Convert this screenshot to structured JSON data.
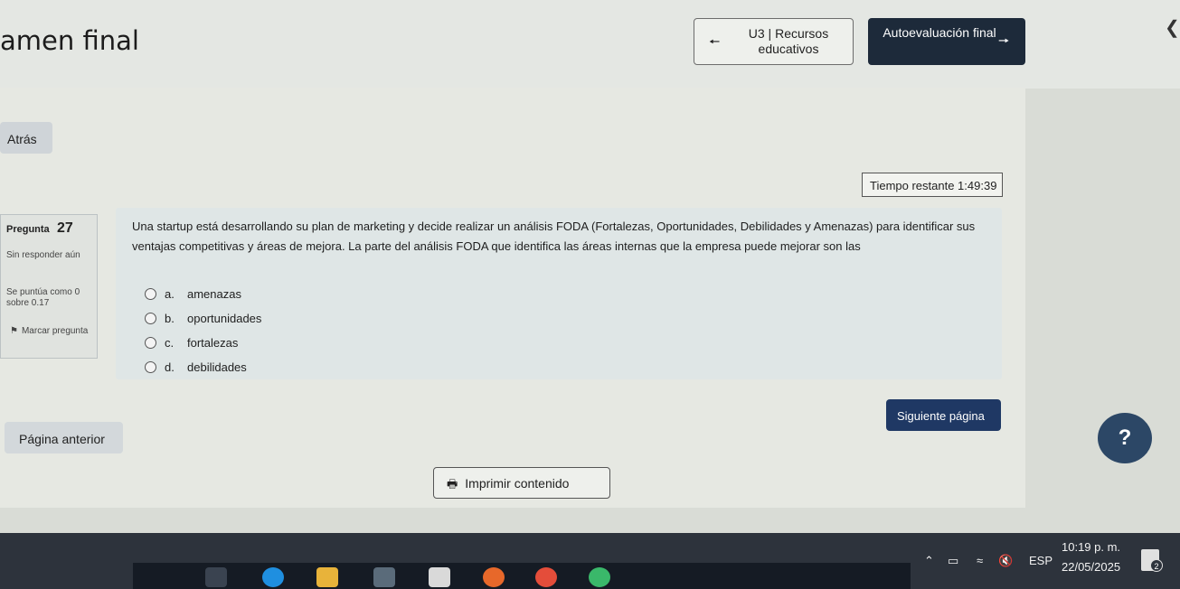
{
  "header": {
    "title": "amen final",
    "prev_nav_label": "U3 | Recursos educativos",
    "next_nav_label": "Autoevaluación final"
  },
  "nav": {
    "back_label": "Atrás",
    "timer_label": "Tiempo restante 1:49:39"
  },
  "question": {
    "label": "Pregunta",
    "number": "27",
    "state": "Sin responder aún",
    "score": "Se puntúa como 0 sobre 0.17",
    "flag_label": "Marcar pregunta",
    "text": "Una startup está desarrollando su plan de marketing y decide realizar un análisis FODA (Fortalezas, Oportunidades, Debilidades y Amenazas) para identificar sus ventajas competitivas y áreas de mejora. La parte del análisis FODA que identifica las áreas internas que la empresa puede mejorar son las",
    "answers": [
      {
        "letter": "a.",
        "text": "amenazas"
      },
      {
        "letter": "b.",
        "text": "oportunidades"
      },
      {
        "letter": "c.",
        "text": "fortalezas"
      },
      {
        "letter": "d.",
        "text": "debilidades"
      }
    ]
  },
  "footer": {
    "prev_page_label": "Página anterior",
    "next_page_label": "Siguiente página",
    "print_label": "Imprimir contenido",
    "help_label": "?"
  },
  "taskbar": {
    "language": "ESP",
    "time": "10:19 p. m.",
    "date": "22/05/2025",
    "notifications": "2"
  },
  "icons": {
    "prev_arrow": "arrow-left-icon",
    "next_arrow": "arrow-right-icon",
    "print": "printer-icon",
    "flag": "flag-icon"
  },
  "colors": {
    "primary_dark": "#1d2a3a",
    "next_page_button": "#1f3864",
    "question_box": "#dfe6e6",
    "taskbar": "#2d333c"
  }
}
